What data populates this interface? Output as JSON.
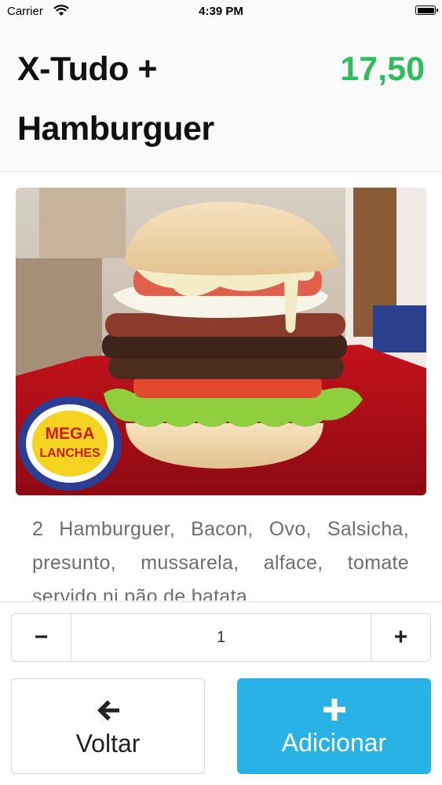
{
  "status_bar": {
    "carrier": "Carrier",
    "time": "4:39 PM"
  },
  "product": {
    "title": "X-Tudo + Hamburguer",
    "price": "17,50",
    "price_color": "#2dbd5b",
    "image_alt": "X-Tudo hamburger photo",
    "logo_text_line1": "MEGA",
    "logo_text_line2": "LANCHES",
    "description": "2 Hamburguer, Bacon, Ovo, Salsicha, presunto, mussarela, alface, tomate servido ni pão de batata"
  },
  "quantity": {
    "decrement_label": "−",
    "value": "1",
    "increment_label": "+"
  },
  "actions": {
    "back_label": "Voltar",
    "back_icon": "arrow-left-icon",
    "add_label": "Adicionar",
    "add_icon": "plus-icon",
    "add_color": "#29b2e6"
  }
}
